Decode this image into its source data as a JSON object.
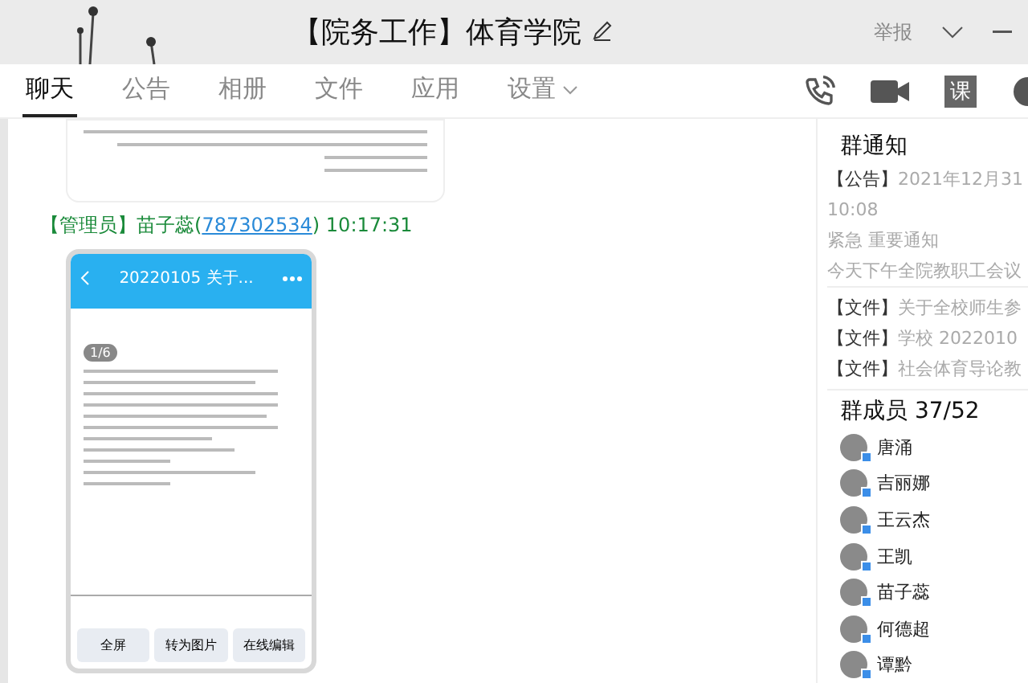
{
  "window": {
    "title": "【院务工作】体育学院",
    "actions": [
      "举报"
    ]
  },
  "tabs": [
    {
      "label": "聊天",
      "selected": true
    },
    {
      "label": "公告",
      "selected": false
    },
    {
      "label": "相册",
      "selected": false
    },
    {
      "label": "文件",
      "selected": false
    },
    {
      "label": "应用",
      "selected": false
    },
    {
      "label": "设置",
      "selected": false,
      "dropdown": true
    }
  ],
  "toolbar": [
    {
      "kind": "phone"
    },
    {
      "kind": "video"
    },
    {
      "kind": "text",
      "label": "课"
    }
  ],
  "messages": [
    {
      "kind": "document"
    },
    {
      "kind": "phone",
      "role": "【管理员】",
      "sender": "苗子蕊",
      "qq_open": "(",
      "qq": "787302534",
      "qq_close": ")",
      "time": "10:17:31",
      "phone": {
        "title": "20220105 关于...",
        "page": "1/6",
        "buttons": [
          "全屏",
          "转为图片",
          "在线编辑"
        ]
      }
    }
  ],
  "notice": {
    "title": "群通知",
    "tag": "【公告】",
    "date": "2021年12月31",
    "time": "10:08",
    "subject": "紧急 重要通知",
    "preview": "今天下午全院教职工会议",
    "files": [
      {
        "tag": "【文件】",
        "name": "关于全校师生参"
      },
      {
        "tag": "【文件】",
        "name": "学校 2022010"
      },
      {
        "tag": "【文件】",
        "name": "社会体育导论教"
      }
    ]
  },
  "members": {
    "title": "群成员 37/52",
    "items": [
      {
        "name": "唐涌"
      },
      {
        "name": "吉丽娜"
      },
      {
        "name": "王云杰"
      },
      {
        "name": "王凯"
      },
      {
        "name": "苗子蕊"
      },
      {
        "name": "何德超"
      },
      {
        "name": "谭黔"
      }
    ]
  }
}
